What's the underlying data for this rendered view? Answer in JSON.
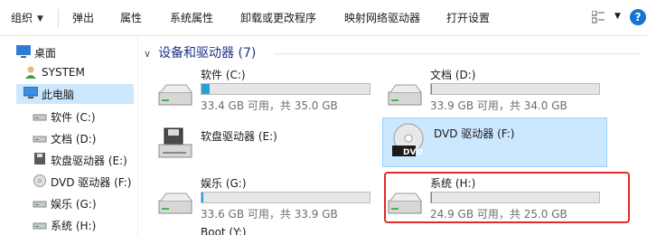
{
  "toolbar": {
    "organize": "组织",
    "eject": "弹出",
    "properties": "属性",
    "system_properties": "系统属性",
    "uninstall": "卸载或更改程序",
    "map_drive": "映射网络驱动器",
    "open_settings": "打开设置",
    "help": "?"
  },
  "sidebar": {
    "items": [
      {
        "label": "桌面",
        "icon": "desktop-icon"
      },
      {
        "label": "SYSTEM",
        "icon": "user-icon"
      },
      {
        "label": "此电脑",
        "icon": "computer-icon"
      },
      {
        "label": "软件 (C:)",
        "icon": "drive-icon"
      },
      {
        "label": "文档 (D:)",
        "icon": "drive-icon"
      },
      {
        "label": "软盘驱动器 (E:)",
        "icon": "floppy-icon"
      },
      {
        "label": "DVD 驱动器 (F:)",
        "icon": "dvd-icon"
      },
      {
        "label": "娱乐 (G:)",
        "icon": "drive-icon"
      },
      {
        "label": "系统 (H:)",
        "icon": "drive-icon"
      }
    ]
  },
  "main": {
    "group_title": "设备和驱动器 (7)",
    "drives": [
      {
        "name": "软件 (C:)",
        "info": "33.4 GB 可用，共 35.0 GB",
        "used_fraction": 0.046,
        "type": "hdd"
      },
      {
        "name": "文档 (D:)",
        "info": "33.9 GB 可用，共 34.0 GB",
        "used_fraction": 0.003,
        "type": "hdd"
      },
      {
        "name": "软盘驱动器 (E:)",
        "info": "",
        "type": "floppy"
      },
      {
        "name": "DVD 驱动器 (F:)",
        "info": "",
        "type": "dvd",
        "badge": "DVD"
      },
      {
        "name": "娱乐 (G:)",
        "info": "33.6 GB 可用，共 33.9 GB",
        "used_fraction": 0.009,
        "type": "hdd"
      },
      {
        "name": "系统 (H:)",
        "info": "24.9 GB 可用，共 25.0 GB",
        "used_fraction": 0.004,
        "type": "hdd"
      },
      {
        "name": "Boot (Y:)",
        "info": "",
        "type": "hdd"
      }
    ]
  },
  "colors": {
    "selection": "#cce8ff",
    "bar_fill": "#26a0da",
    "highlight_box": "#e02b2b",
    "header": "#1e3287"
  }
}
